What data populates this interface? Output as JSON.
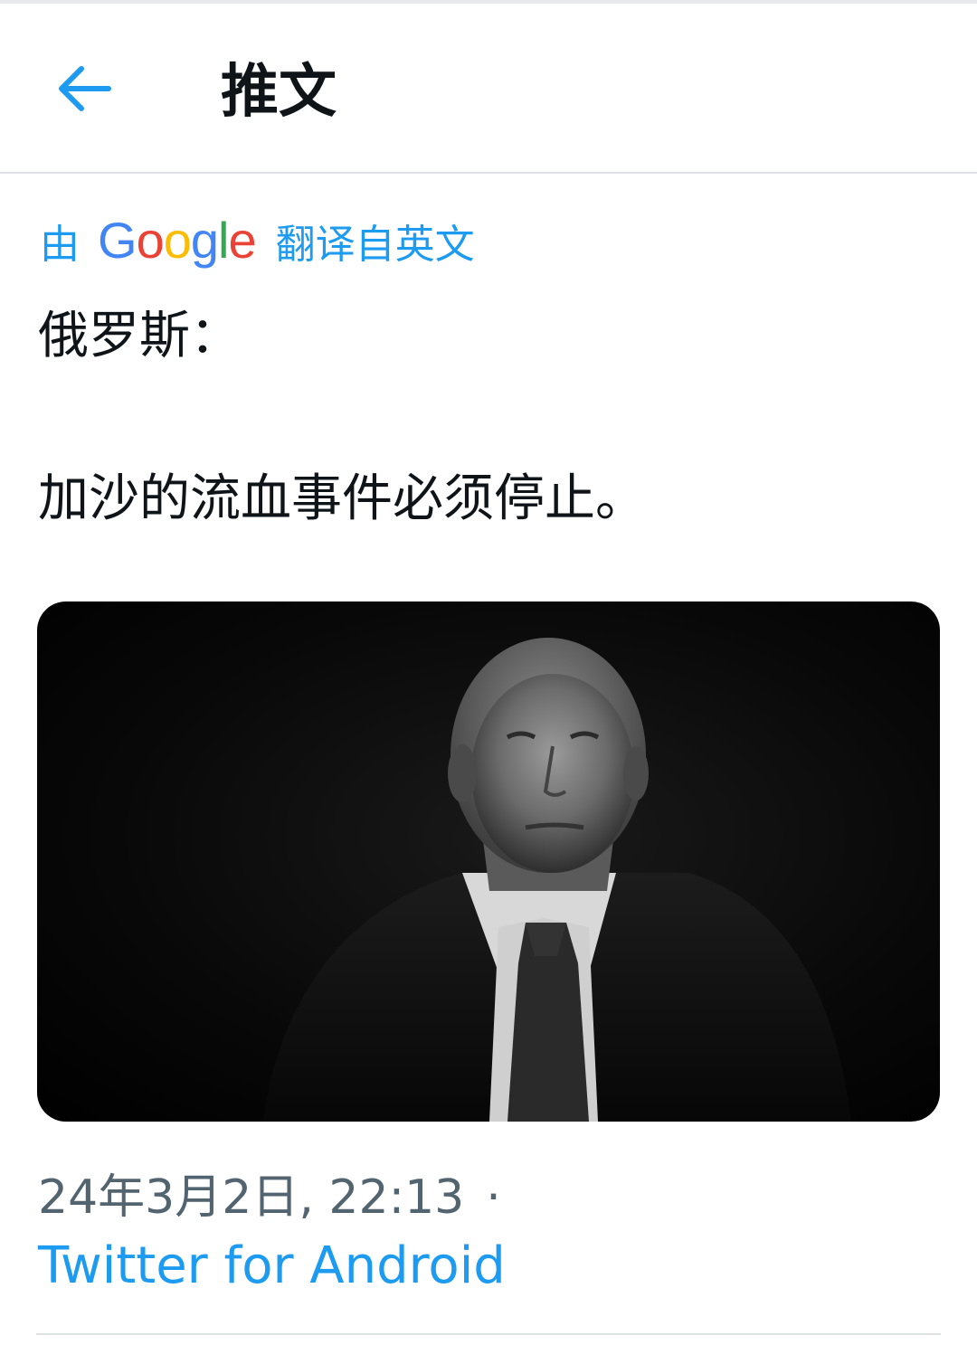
{
  "header": {
    "title": "推文",
    "back_icon": "arrow-left-icon"
  },
  "translation": {
    "prefix": "由",
    "provider": "Google",
    "suffix": "翻译自英文"
  },
  "tweet": {
    "line1": "俄罗斯：",
    "line2": "加沙的流血事件必须停止。",
    "image_description": "black-and-white portrait photo"
  },
  "meta": {
    "timestamp": "24年3月2日, 22:13",
    "separator": "·",
    "source": "Twitter for Android"
  },
  "colors": {
    "accent": "#1d9bf0",
    "text": "#0f1419",
    "secondary": "#536471"
  }
}
